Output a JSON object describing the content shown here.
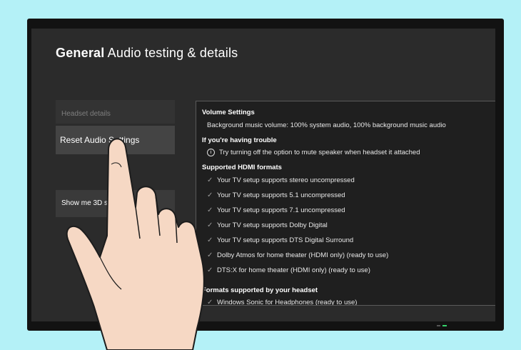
{
  "header": {
    "title_strong": "General",
    "title_rest": "Audio testing & details"
  },
  "sidebar": {
    "items": [
      {
        "label": "Headset details"
      },
      {
        "label": "Reset Audio Settings"
      },
      {
        "label": "Show me 3D spatial audio"
      }
    ]
  },
  "panel": {
    "volume": {
      "heading": "Volume Settings",
      "line": "Background music volume: 100% system audio, 100% background music audio"
    },
    "trouble": {
      "heading": "If you're having trouble",
      "line": "Try turning off the option to mute speaker when headset it attached"
    },
    "hdmi": {
      "heading": "Supported HDMI formats",
      "items": [
        "Your TV setup supports stereo uncompressed",
        "Your TV setup supports 5.1 uncompressed",
        "Your TV setup supports 7.1 uncompressed",
        "Your TV setup supports Dolby Digital",
        "Your TV setup supports DTS Digital Surround",
        "Dolby Atmos for home theater (HDMI only) (ready to use)",
        "DTS:X for home theater (HDMI only) (ready to use)"
      ]
    },
    "headset_formats": {
      "heading": "Formats supported by your headset",
      "items": [
        "Windows Sonic for Headphones (ready to use)"
      ]
    }
  },
  "icons": {
    "check": "check-icon",
    "info": "info-icon"
  }
}
